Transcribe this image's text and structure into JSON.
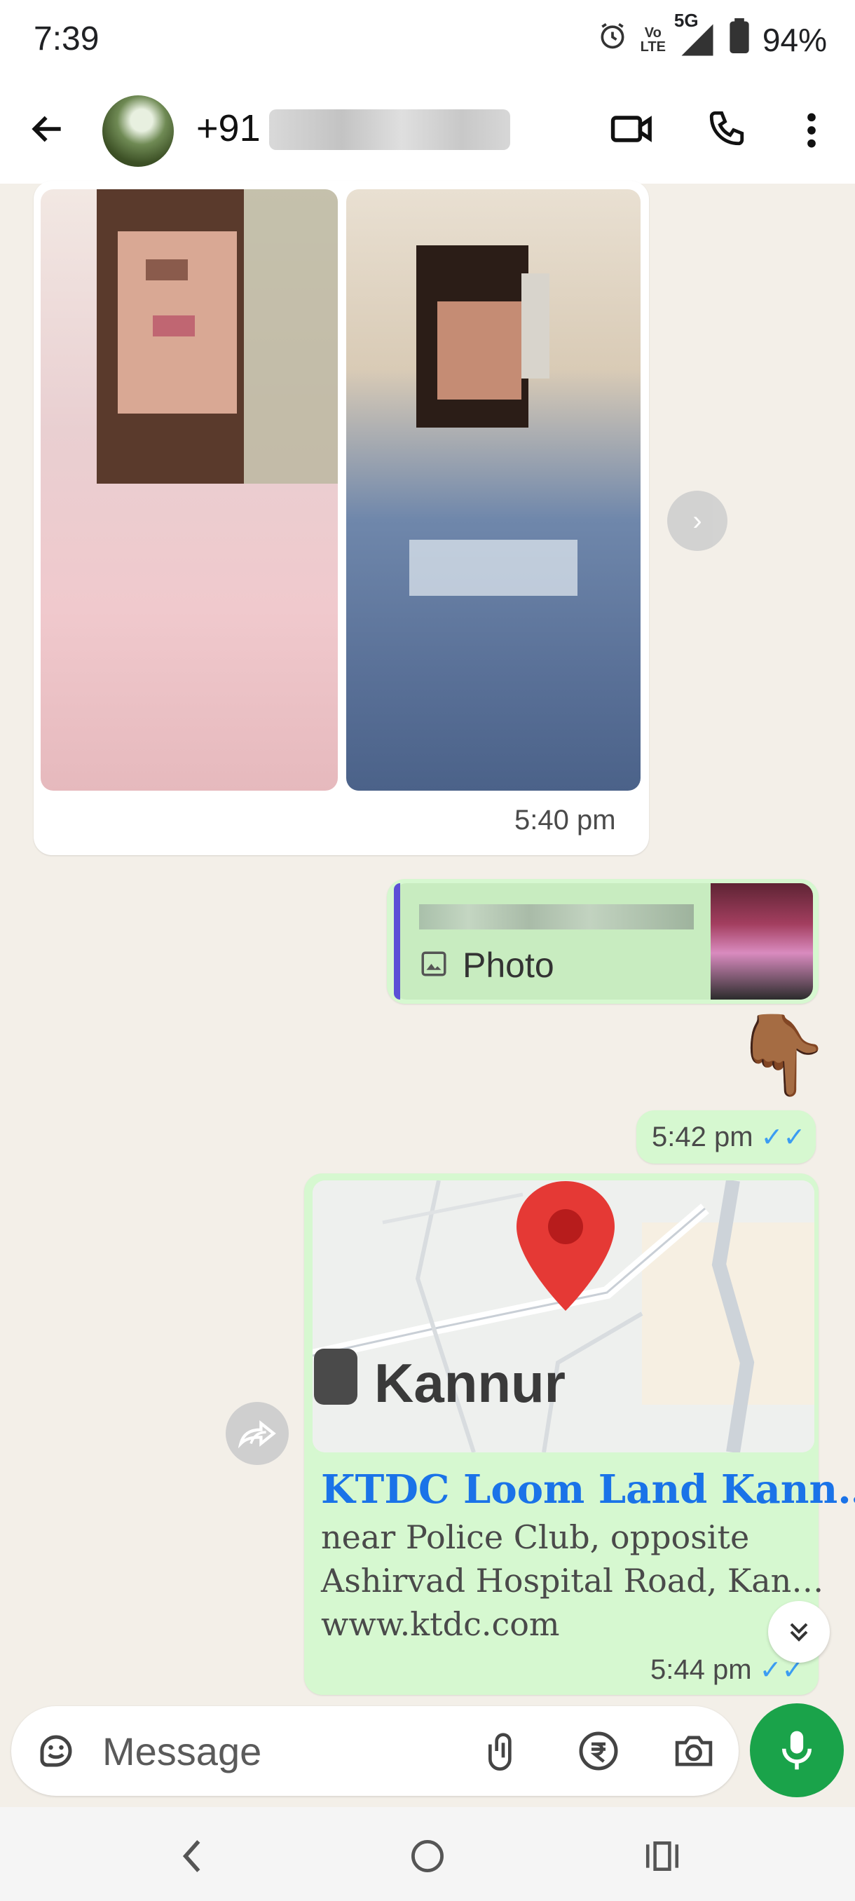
{
  "status_bar": {
    "time": "7:39",
    "network": "5G",
    "volte_line1": "Vo",
    "volte_line2": "LTE",
    "battery": "94%"
  },
  "header": {
    "contact_prefix": "+91",
    "contact_name_redacted": true
  },
  "messages": {
    "incoming_images": {
      "time": "5:40 pm"
    },
    "reply": {
      "quoted_type": "Photo"
    },
    "emoji": "👇🏾",
    "emoji_time": "5:42 pm",
    "location": {
      "map_label": "Kannur",
      "title": "KTDC Loom Land Kann…",
      "address_line1": "near Police Club, opposite",
      "address_line2": "Ashirvad Hospital Road, Kan…",
      "url": "www.ktdc.com",
      "time": "5:44 pm"
    }
  },
  "input": {
    "placeholder": "Message"
  },
  "colors": {
    "accent_green": "#1aa34a",
    "outgoing_bubble": "#d6f8d0",
    "link_blue": "#1a73e8",
    "read_ticks": "#3b9cf2"
  }
}
